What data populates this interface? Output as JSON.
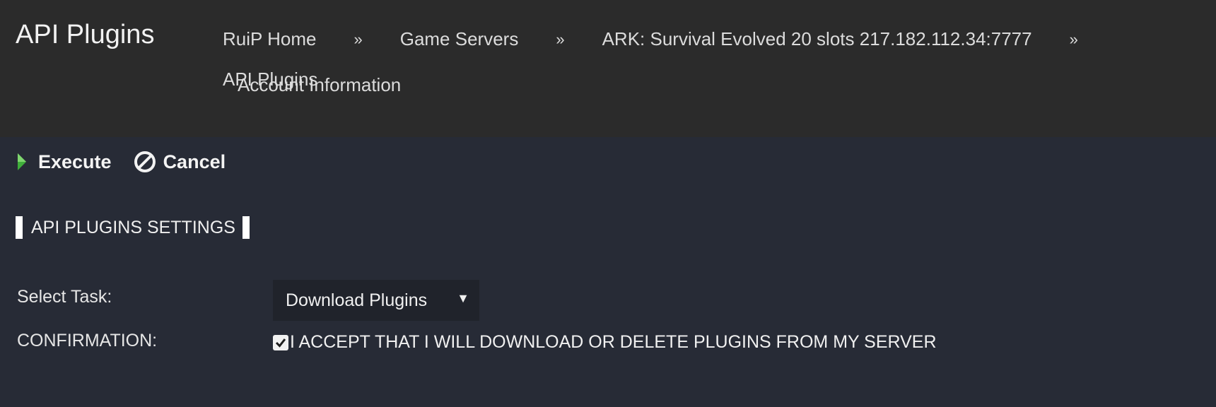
{
  "header": {
    "title": "API Plugins",
    "breadcrumb": [
      {
        "label": "RuiP Home"
      },
      {
        "label": "Game Servers"
      },
      {
        "label": "ARK: Survival Evolved 20 slots 217.182.112.34:7777"
      },
      {
        "label": "API Plugins"
      }
    ],
    "separator": "»",
    "account_link": "Account Information"
  },
  "toolbar": {
    "execute_label": "Execute",
    "cancel_label": "Cancel",
    "execute_icon": "play-icon",
    "cancel_icon": "cancel-circle-icon"
  },
  "section": {
    "title": "API PLUGINS SETTINGS"
  },
  "form": {
    "task_label": "Select Task:",
    "task_value": "Download Plugins",
    "task_arrow": "▼",
    "confirmation_label": "CONFIRMATION:",
    "confirmation_checked": true,
    "confirmation_text": "I ACCEPT THAT I WILL DOWNLOAD OR DELETE PLUGINS FROM MY SERVER"
  },
  "colors": {
    "header_bg": "#2b2b2b",
    "content_bg": "#272b36",
    "select_bg": "#20232b",
    "execute_icon_green": "#3fae3b"
  }
}
